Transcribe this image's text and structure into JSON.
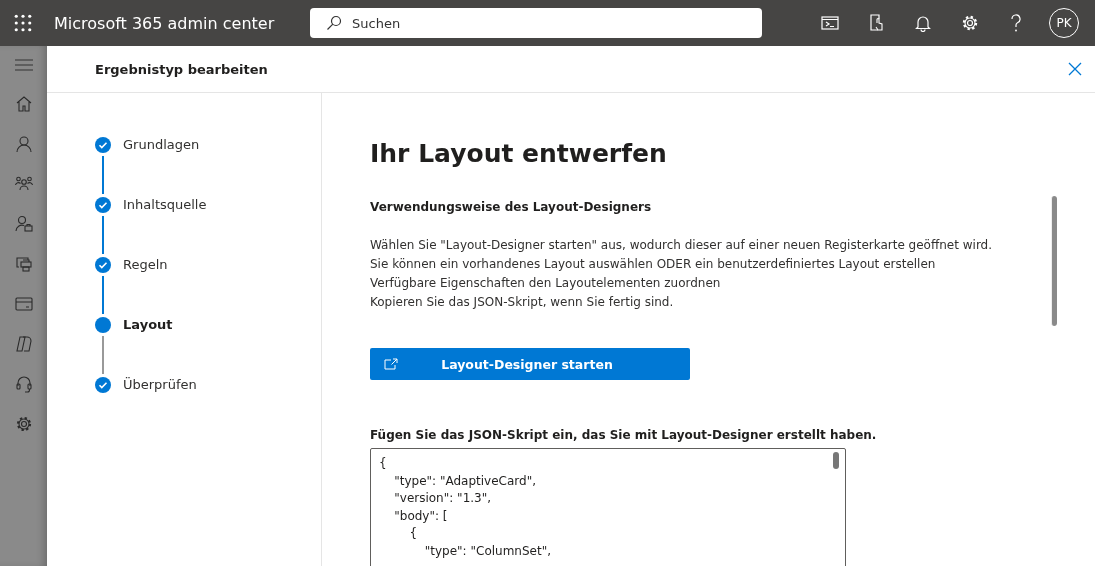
{
  "topbar": {
    "title": "Microsoft 365 admin center",
    "search": {
      "placeholder": "Suchen"
    },
    "avatar": "PK"
  },
  "panel": {
    "title": "Ergebnistyp bearbeiten",
    "steps": [
      {
        "label": "Grundlagen",
        "completed": true,
        "selected": false
      },
      {
        "label": "Inhaltsquelle",
        "completed": true,
        "selected": false
      },
      {
        "label": "Regeln",
        "completed": true,
        "selected": false
      },
      {
        "label": "Layout",
        "completed": false,
        "selected": true
      },
      {
        "label": "Überprüfen",
        "completed": true,
        "selected": false
      }
    ],
    "heading": "Ihr Layout entwerfen",
    "subheading": "Verwendungsweise des Layout-Designers",
    "instructions": [
      "Wählen Sie \"Layout-Designer starten\" aus, wodurch dieser auf einer neuen Registerkarte geöffnet wird.",
      "Sie können ein vorhandenes Layout auswählen ODER ein benutzerdefiniertes Layout erstellen",
      "Verfügbare Eigenschaften den Layoutelementen zuordnen",
      "Kopieren Sie das JSON-Skript, wenn Sie fertig sind."
    ],
    "launch_button": "Layout-Designer starten",
    "json_label": "Fügen Sie das JSON-Skript ein, das Sie mit Layout-Designer erstellt haben.",
    "json_value": "{\n    \"type\": \"AdaptiveCard\",\n    \"version\": \"1.3\",\n    \"body\": [\n        {\n            \"type\": \"ColumnSet\","
  }
}
